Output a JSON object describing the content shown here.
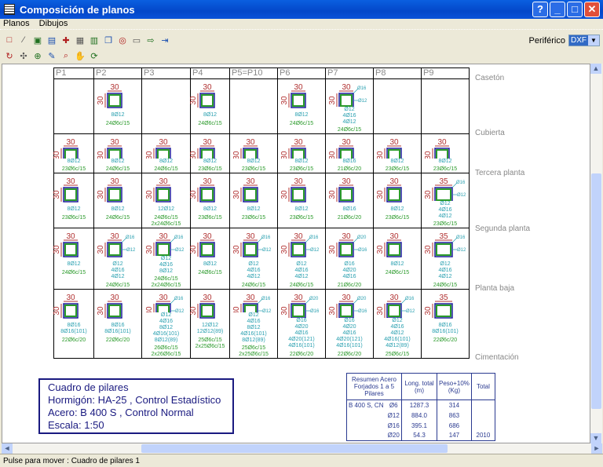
{
  "window": {
    "title": "Composición de planos",
    "help": "?",
    "minimize": "_",
    "maximize": "□",
    "close": "✕"
  },
  "menu": [
    "Planos",
    "Dibujos"
  ],
  "toolbar1": [
    "new-icon",
    "delete-icon",
    "print-icon",
    "print-setup-icon",
    "layout-icon",
    "layout2-icon",
    "view-table-icon",
    "copy-icon",
    "zoom-view-icon",
    "frame-icon",
    "export-icon",
    "exit-icon"
  ],
  "toolbar2": [
    "rotate-icon",
    "move-icon",
    "zoom-icon",
    "edit-icon",
    "zoom-window-icon",
    "pan-icon",
    "refresh-icon"
  ],
  "periferico": {
    "label": "Periférico",
    "value": "DXF"
  },
  "columns": [
    "P1",
    "P2",
    "P3",
    "P4",
    "P5=P10",
    "P6",
    "P7",
    "P8",
    "P9"
  ],
  "floors": [
    "Casetón",
    "Cubierta",
    "Tercera planta",
    "Segunda planta",
    "Planta baja",
    "Cimentación"
  ],
  "colors": {
    "dim": "#b03030",
    "bars": "#2aa0b0",
    "stirrups": "#2a9a2a",
    "outline": "#1a1a9a"
  },
  "rows": [
    [
      null,
      {
        "w": "30",
        "d": "30",
        "bars": [
          "8Ø12"
        ],
        "st": [
          "24Ø6c/15"
        ]
      },
      null,
      {
        "w": "30",
        "d": "30",
        "bars": [
          "8Ø12"
        ],
        "st": [
          "24Ø6c/15"
        ]
      },
      null,
      {
        "w": "30",
        "d": "30",
        "bars": [
          "8Ø12"
        ],
        "st": [
          "24Ø6c/15"
        ]
      },
      {
        "w": "30",
        "d": "30",
        "call": [
          "Ø16",
          "Ø12",
          "Ø12"
        ],
        "bars": [
          "4Ø16",
          "4Ø12"
        ],
        "st": [
          "24Ø6c/15"
        ]
      },
      null,
      null
    ],
    [
      {
        "w": "30",
        "d": "30",
        "bars": [
          "8Ø12"
        ],
        "st": [
          "23Ø6c/15"
        ]
      },
      {
        "w": "30",
        "d": "30",
        "bars": [
          "8Ø12"
        ],
        "st": [
          "24Ø6c/15"
        ]
      },
      {
        "w": "30",
        "d": "30",
        "bars": [
          "8Ø12"
        ],
        "st": [
          "24Ø6c/15"
        ]
      },
      {
        "w": "30",
        "d": "30",
        "bars": [
          "8Ø12"
        ],
        "st": [
          "23Ø6c/15"
        ]
      },
      {
        "w": "30",
        "d": "30",
        "bars": [
          "8Ø12"
        ],
        "st": [
          "23Ø6c/15"
        ]
      },
      {
        "w": "30",
        "d": "30",
        "bars": [
          "8Ø12"
        ],
        "st": [
          "23Ø6c/15"
        ]
      },
      {
        "w": "30",
        "d": "30",
        "bars": [
          "8Ø16"
        ],
        "st": [
          "21Ø6c/20"
        ]
      },
      {
        "w": "30",
        "d": "30",
        "bars": [
          "8Ø12"
        ],
        "st": [
          "23Ø6c/15"
        ]
      },
      {
        "w": "30",
        "d": "30",
        "bars": [
          "8Ø12"
        ],
        "st": [
          "23Ø6c/15"
        ]
      }
    ],
    [
      {
        "w": "30",
        "d": "30",
        "bars": [
          "8Ø12"
        ],
        "st": [
          "23Ø6c/15"
        ]
      },
      {
        "w": "30",
        "d": "30",
        "bars": [
          "8Ø12"
        ],
        "st": [
          "24Ø6c/15"
        ]
      },
      {
        "w": "30",
        "d": "30",
        "bars": [
          "12Ø12"
        ],
        "st": [
          "24Ø6c/15",
          "2x24Ø6c/15"
        ]
      },
      {
        "w": "30",
        "d": "30",
        "bars": [
          "8Ø12"
        ],
        "st": [
          "23Ø6c/15"
        ]
      },
      {
        "w": "30",
        "d": "30",
        "bars": [
          "8Ø12"
        ],
        "st": [
          "23Ø6c/15"
        ]
      },
      {
        "w": "30",
        "d": "30",
        "bars": [
          "8Ø12"
        ],
        "st": [
          "23Ø6c/15"
        ]
      },
      {
        "w": "30",
        "d": "30",
        "bars": [
          "8Ø16"
        ],
        "st": [
          "21Ø6c/20"
        ]
      },
      {
        "w": "30",
        "d": "30",
        "bars": [
          "8Ø12"
        ],
        "st": [
          "23Ø6c/15"
        ]
      },
      {
        "w": "35",
        "d": "30",
        "call": [
          "Ø16",
          "Ø12",
          "Ø12"
        ],
        "bars": [
          "4Ø16",
          "4Ø12"
        ],
        "st": [
          "23Ø6c/15"
        ]
      }
    ],
    [
      {
        "w": "30",
        "d": "30",
        "bars": [
          "8Ø12"
        ],
        "st": [
          "24Ø6c/15"
        ]
      },
      {
        "w": "30",
        "d": "30",
        "call": [
          "Ø16",
          "Ø12",
          "Ø12"
        ],
        "bars": [
          "4Ø16",
          "4Ø12"
        ],
        "st": [
          "24Ø6c/15"
        ]
      },
      {
        "w": "30",
        "d": "30",
        "call": [
          "Ø16",
          "Ø12",
          "Ø12"
        ],
        "bars": [
          "4Ø16",
          "8Ø12"
        ],
        "st": [
          "24Ø6c/15",
          "2x24Ø6c/15"
        ]
      },
      {
        "w": "30",
        "d": "30",
        "bars": [
          "8Ø12"
        ],
        "st": [
          "24Ø6c/15"
        ]
      },
      {
        "w": "30",
        "d": "30",
        "call": [
          "Ø16",
          "Ø12",
          "Ø12"
        ],
        "bars": [
          "4Ø16",
          "4Ø12"
        ],
        "st": [
          "24Ø6c/15"
        ]
      },
      {
        "w": "30",
        "d": "30",
        "call": [
          "Ø16",
          "Ø12",
          "Ø12"
        ],
        "bars": [
          "4Ø16",
          "4Ø12"
        ],
        "st": [
          "24Ø6c/15"
        ]
      },
      {
        "w": "30",
        "d": "30",
        "call": [
          "Ø20",
          "Ø16",
          "Ø16"
        ],
        "bars": [
          "4Ø20",
          "4Ø16"
        ],
        "st": [
          "21Ø6c/20"
        ]
      },
      {
        "w": "30",
        "d": "30",
        "bars": [
          "8Ø12"
        ],
        "st": [
          "24Ø6c/15"
        ]
      },
      {
        "w": "35",
        "d": "30",
        "call": [
          "Ø16",
          "Ø12",
          "Ø12"
        ],
        "bars": [
          "4Ø16",
          "4Ø12"
        ],
        "st": [
          "24Ø6c/15"
        ]
      }
    ],
    [
      {
        "w": "30",
        "d": "30",
        "bars": [
          "8Ø16",
          "8Ø16(101)"
        ],
        "st": [
          "22Ø6c/20"
        ]
      },
      {
        "w": "30",
        "d": "30",
        "bars": [
          "8Ø16",
          "8Ø16(101)"
        ],
        "st": [
          "22Ø6c/20"
        ]
      },
      {
        "w": "30",
        "d": "30",
        "call": [
          "Ø16",
          "Ø12",
          "Ø12"
        ],
        "bars": [
          "4Ø16",
          "8Ø12",
          "4Ø16(101)",
          "8Ø12(89)"
        ],
        "st": [
          "26Ø6c/15",
          "2x26Ø6c/15"
        ]
      },
      {
        "w": "30",
        "d": "30",
        "bars": [
          "12Ø12",
          "12Ø12(89)"
        ],
        "st": [
          "25Ø6c/15",
          "2x25Ø6c/15"
        ]
      },
      {
        "w": "30",
        "d": "30",
        "call": [
          "Ø16",
          "Ø12",
          "Ø12"
        ],
        "bars": [
          "4Ø16",
          "8Ø12",
          "4Ø16(101)",
          "8Ø12(89)"
        ],
        "st": [
          "25Ø6c/15",
          "2x25Ø6c/15"
        ]
      },
      {
        "w": "30",
        "d": "30",
        "call": [
          "Ø20",
          "Ø16",
          "Ø16"
        ],
        "bars": [
          "4Ø20",
          "4Ø16",
          "4Ø20(121)",
          "4Ø16(101)"
        ],
        "st": [
          "22Ø6c/20"
        ]
      },
      {
        "w": "30",
        "d": "30",
        "call": [
          "Ø20",
          "Ø16",
          "Ø16"
        ],
        "bars": [
          "4Ø20",
          "4Ø16",
          "4Ø20(121)",
          "4Ø16(101)"
        ],
        "st": [
          "22Ø6c/20"
        ]
      },
      {
        "w": "30",
        "d": "30",
        "call": [
          "Ø16",
          "Ø12",
          "Ø12"
        ],
        "bars": [
          "4Ø16",
          "4Ø12",
          "4Ø16(101)",
          "4Ø12(89)"
        ],
        "st": [
          "25Ø6c/15"
        ]
      },
      {
        "w": "35",
        "d": "30",
        "bars": [
          "8Ø16",
          "8Ø16(101)"
        ],
        "st": [
          "22Ø6c/20"
        ]
      }
    ]
  ],
  "legend": {
    "title": "Cuadro de pilares",
    "hormigon": "Hormigón:  HA-25 , Control Estadístico",
    "acero": "Acero:  B 400 S , Control Normal",
    "escala": "Escala: 1:50"
  },
  "summary": {
    "header": [
      "Resumen Acero Forjados 1 a 5 Pilares",
      "Long. total (m)",
      "Peso+10% (Kg)",
      "Total"
    ],
    "steel": "B 400 S, CN",
    "rows": [
      {
        "d": "Ø6",
        "len": "1287.3",
        "w": "314"
      },
      {
        "d": "Ø12",
        "len": "884.0",
        "w": "863"
      },
      {
        "d": "Ø16",
        "len": "395.1",
        "w": "686"
      },
      {
        "d": "Ø20",
        "len": "54.3",
        "w": "147"
      }
    ],
    "total": "2010"
  },
  "status": "Pulse para mover : Cuadro de pilares 1"
}
